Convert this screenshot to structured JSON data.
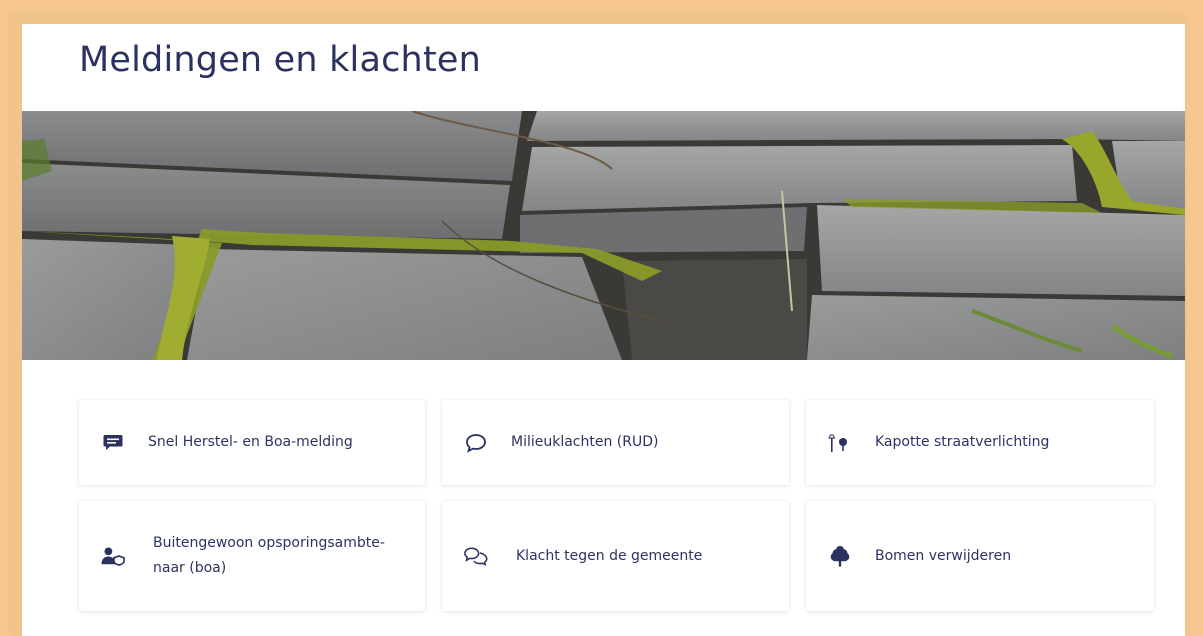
{
  "header": {
    "title": "Meldingen en klachten"
  },
  "tiles": [
    {
      "label": "Snel Herstel- en Boa-melding",
      "icon": "message-square-icon"
    },
    {
      "label": "Milieuklachten (RUD)",
      "icon": "speech-bubble-icon"
    },
    {
      "label": "Kapotte straatverlichting",
      "icon": "street-light-icon"
    },
    {
      "label": "Buitengewoon opsporingsambte-naar (boa)",
      "icon": "user-shield-icon"
    },
    {
      "label": "Klacht tegen de gemeente",
      "icon": "conversation-icon"
    },
    {
      "label": "Bomen verwijderen",
      "icon": "tree-icon"
    }
  ],
  "colors": {
    "accent": "#2b3260",
    "frame": "#f5c68e",
    "moss": "#8a9a2a"
  }
}
